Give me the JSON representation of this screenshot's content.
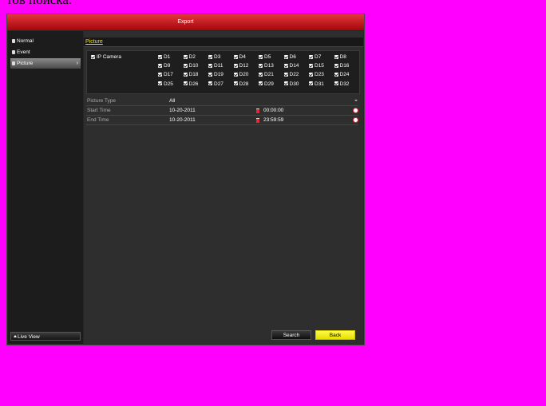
{
  "top_fragment": "тов поиска.",
  "window": {
    "title": "Export"
  },
  "sidebar": {
    "items": [
      {
        "label": "Normal",
        "icon": "folder-icon"
      },
      {
        "label": "Event",
        "icon": "event-icon"
      },
      {
        "label": "Picture",
        "icon": "picture-icon",
        "active": true
      }
    ],
    "live_view": "Live View"
  },
  "section": {
    "title": "Picture"
  },
  "camera": {
    "master_label": "IP Camera",
    "channels": [
      "D1",
      "D2",
      "D3",
      "D4",
      "D5",
      "D6",
      "D7",
      "D8",
      "D9",
      "D10",
      "D11",
      "D12",
      "D13",
      "D14",
      "D15",
      "D16",
      "D17",
      "D18",
      "D19",
      "D20",
      "D21",
      "D22",
      "D23",
      "D24",
      "D25",
      "D26",
      "D27",
      "D28",
      "D29",
      "D30",
      "D31",
      "D32"
    ]
  },
  "fields": {
    "picture_type": {
      "label": "Picture Type",
      "value": "All"
    },
    "start_time": {
      "label": "Start Time",
      "date": "10-20-2011",
      "time": "00:00:00"
    },
    "end_time": {
      "label": "End Time",
      "date": "10-20-2011",
      "time": "23:59:59"
    }
  },
  "buttons": {
    "search": "Search",
    "back": "Back"
  },
  "colors": {
    "title_red": "#c8151b",
    "accent_yellow": "#f5e400",
    "background": "#ff00ff"
  }
}
